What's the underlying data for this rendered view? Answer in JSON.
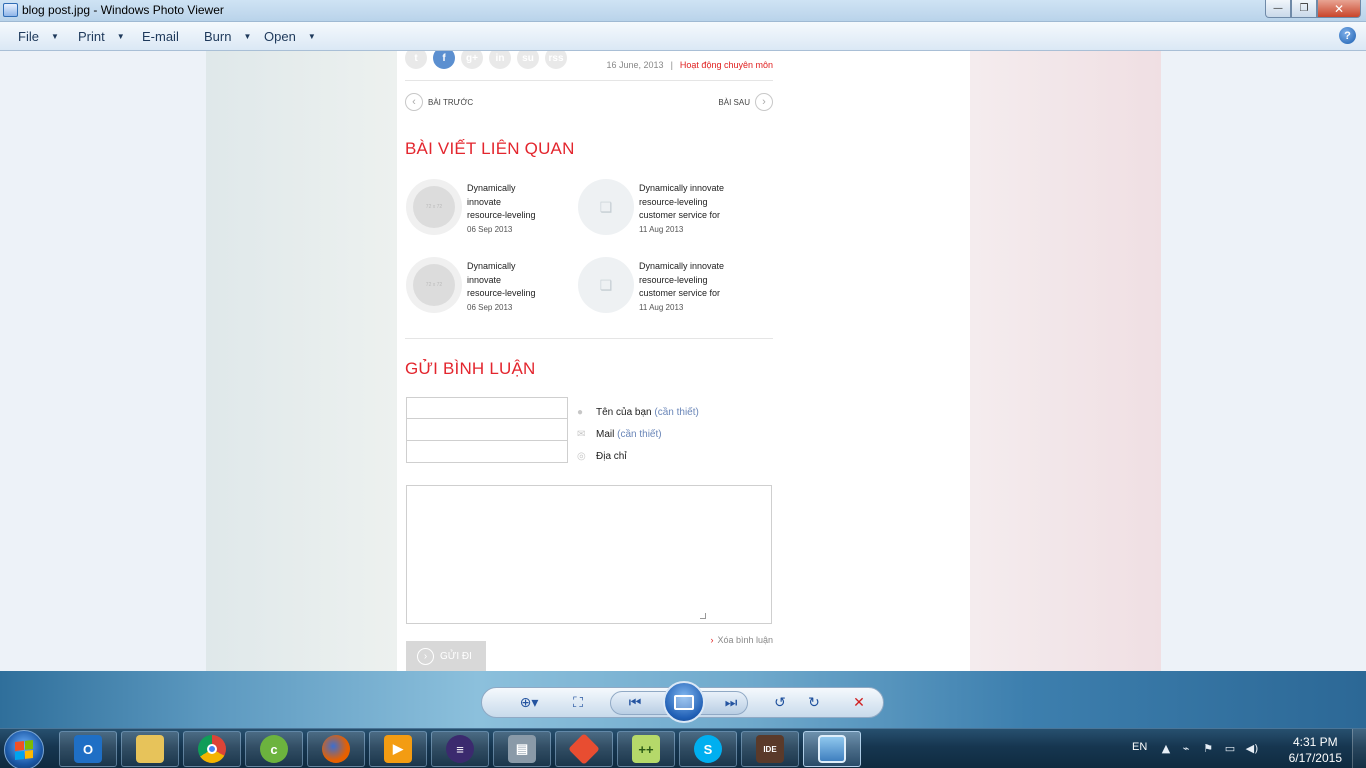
{
  "window": {
    "title": "blog post.jpg - Windows Photo Viewer",
    "minimize": "—",
    "restore": "❐",
    "close": "✕"
  },
  "menu": {
    "file": "File",
    "print": "Print",
    "email": "E-mail",
    "burn": "Burn",
    "open": "Open",
    "help": "?"
  },
  "post": {
    "social": [
      "t",
      "f",
      "g+",
      "in",
      "su",
      "rss"
    ],
    "date": "16 June, 2013",
    "separator": "|",
    "category": "Hoạt động chuyên môn",
    "prev": "BÀI TRƯỚC",
    "next": "BÀI SAU"
  },
  "related": {
    "title": "BÀI VIẾT LIÊN QUAN",
    "thumb_label": "72 x 72",
    "items": [
      {
        "lines": [
          "Dynamically",
          "innovate",
          "resource-leveling"
        ],
        "date": "06 Sep 2013"
      },
      {
        "lines": [
          "Dynamically innovate",
          "resource-leveling",
          "customer service for"
        ],
        "date": "11 Aug 2013"
      },
      {
        "lines": [
          "Dynamically",
          "innovate",
          "resource-leveling"
        ],
        "date": "06 Sep 2013"
      },
      {
        "lines": [
          "Dynamically innovate",
          "resource-leveling",
          "customer service for"
        ],
        "date": "11 Aug 2013"
      }
    ]
  },
  "comment": {
    "title": "GỬI BÌNH LUẬN",
    "name_label": "Tên của bạn",
    "name_req": "(cần thiết)",
    "mail_label": "Mail",
    "mail_req": "(cần thiết)",
    "address_label": "Địa chỉ",
    "clear": "Xóa bình luận",
    "submit": "GỬI ĐI"
  },
  "controls": {
    "zoom": "zoom-icon",
    "fit": "actual-size-icon",
    "prev": "previous-icon",
    "slideshow": "slideshow-icon",
    "next": "next-icon",
    "rotate_ccw": "rotate-ccw-icon",
    "rotate_cw": "rotate-cw-icon",
    "delete": "delete-icon"
  },
  "taskbar": {
    "apps": [
      "outlook",
      "explorer",
      "chrome",
      "coccoc",
      "firefox",
      "media-player",
      "eclipse",
      "database",
      "git",
      "notepad++",
      "skype",
      "java-ee-ide",
      "photo-viewer"
    ],
    "language": "EN",
    "time": "4:31 PM",
    "date": "6/17/2015"
  }
}
